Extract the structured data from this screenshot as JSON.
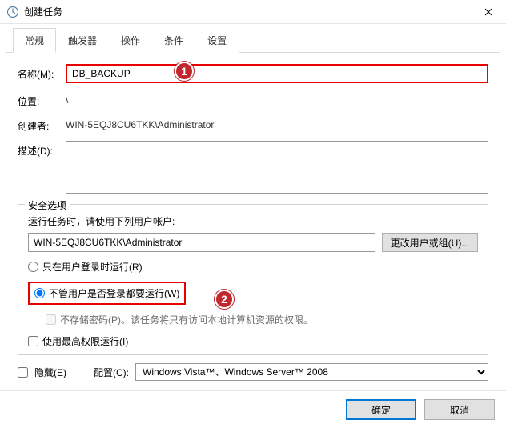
{
  "title": "创建任务",
  "tabs": {
    "general": "常规",
    "triggers": "触发器",
    "actions": "操作",
    "conditions": "条件",
    "settings": "设置"
  },
  "labels": {
    "name": "名称(M):",
    "location": "位置:",
    "creator": "创建者:",
    "description": "描述(D):"
  },
  "values": {
    "name": "DB_BACKUP",
    "location": "\\",
    "creator": "WIN-5EQJ8CU6TKK\\Administrator"
  },
  "security": {
    "legend": "安全选项",
    "runAsPrompt": "运行任务时，请使用下列用户帐户:",
    "account": "WIN-5EQJ8CU6TKK\\Administrator",
    "changeUser": "更改用户或组(U)...",
    "onlyLoggedOn": "只在用户登录时运行(R)",
    "whetherOrNot": "不管用户是否登录都要运行(W)",
    "noStorePwd": "不存储密码(P)。该任务将只有访问本地计算机资源的权限。",
    "highestPriv": "使用最高权限运行(I)"
  },
  "bottom": {
    "hidden": "隐藏(E)",
    "configFor": "配置(C):",
    "configValue": "Windows Vista™、Windows Server™ 2008"
  },
  "buttons": {
    "ok": "确定",
    "cancel": "取消"
  },
  "callouts": {
    "one": "1",
    "two": "2"
  }
}
